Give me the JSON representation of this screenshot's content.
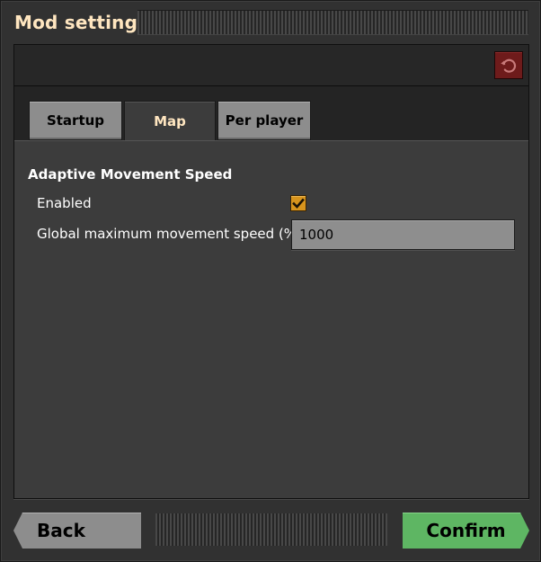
{
  "window": {
    "title": "Mod settings"
  },
  "tabs": [
    {
      "label": "Startup",
      "active": false
    },
    {
      "label": "Map",
      "active": true
    },
    {
      "label": "Per player",
      "active": false
    }
  ],
  "map_settings": {
    "section_title": "Adaptive Movement Speed",
    "enabled_label": "Enabled",
    "enabled": true,
    "speed_label": "Global maximum movement speed (%)",
    "speed_value": "1000"
  },
  "footer": {
    "back_label": "Back",
    "confirm_label": "Confirm"
  },
  "colors": {
    "title_text": "#ffe6c0",
    "reset_button": "#6e1b1b",
    "checkbox": "#d7941d",
    "confirm_button": "#5eb663"
  },
  "icons": {
    "reset": "reset-icon",
    "checkmark": "checkmark-icon"
  }
}
